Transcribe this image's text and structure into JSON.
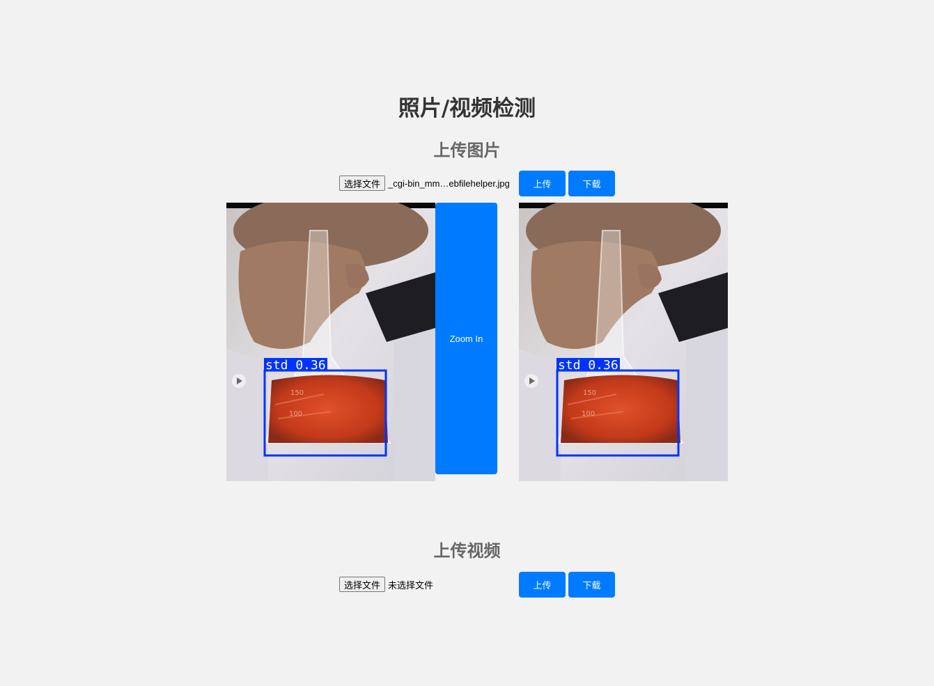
{
  "page": {
    "title": "照片/视频检测"
  },
  "image_section": {
    "heading": "上传图片",
    "choose_file_label": "选择文件",
    "file_name": "_cgi-bin_mm…ebfilehelper.jpg",
    "upload_label": "上传",
    "download_label": "下载",
    "zoom_label": "Zoom In",
    "detection_label": "std 0.36"
  },
  "video_section": {
    "heading": "上传视频",
    "choose_file_label": "选择文件",
    "file_name": "未选择文件",
    "upload_label": "上传",
    "download_label": "下载"
  },
  "colors": {
    "accent": "#007bff",
    "detection_box": "#0033ff"
  }
}
